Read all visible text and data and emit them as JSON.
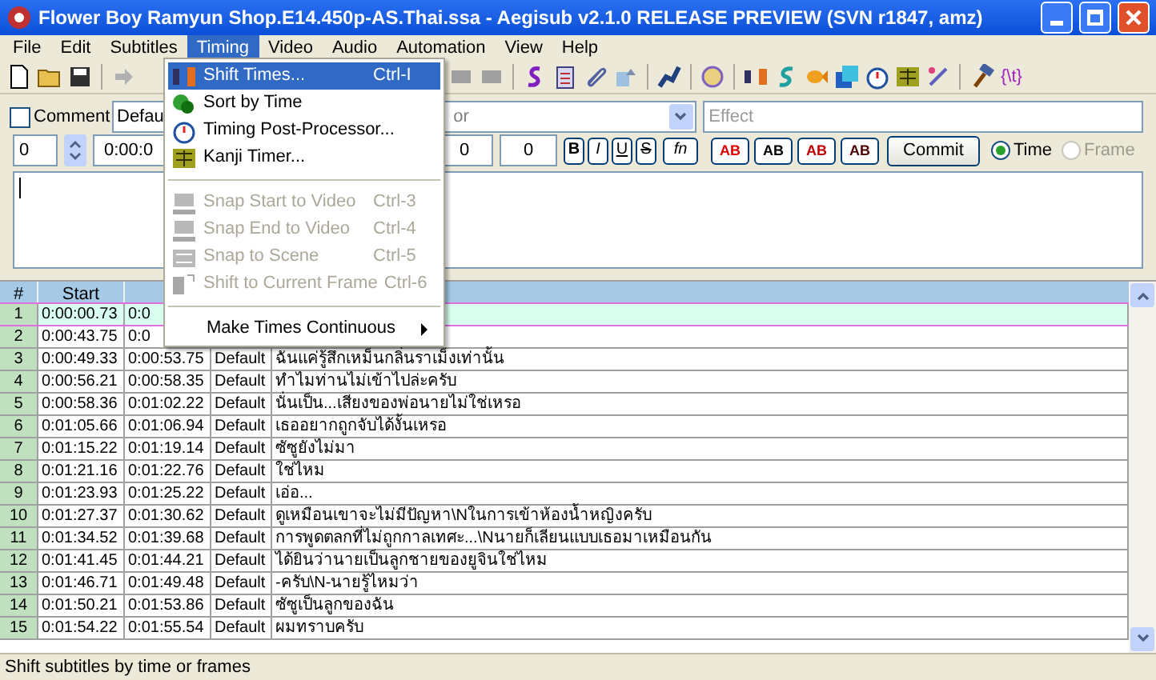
{
  "window": {
    "title": "Flower Boy Ramyun Shop.E14.450p-AS.Thai.ssa - Aegisub v2.1.0 RELEASE PREVIEW (SVN r1847, amz)"
  },
  "menu_bar": [
    {
      "label": "File",
      "selected": false
    },
    {
      "label": "Edit",
      "selected": false
    },
    {
      "label": "Subtitles",
      "selected": false
    },
    {
      "label": "Timing",
      "selected": true
    },
    {
      "label": "Video",
      "selected": false
    },
    {
      "label": "Audio",
      "selected": false
    },
    {
      "label": "Automation",
      "selected": false
    },
    {
      "label": "View",
      "selected": false
    },
    {
      "label": "Help",
      "selected": false
    }
  ],
  "toolbar": {
    "tag_button": "{\\t}"
  },
  "timing_menu": [
    {
      "kind": "item",
      "label": "Shift Times...",
      "shortcut": "Ctrl-I",
      "selected": true,
      "disabled": false
    },
    {
      "kind": "item",
      "label": "Sort by Time",
      "selected": false,
      "disabled": false
    },
    {
      "kind": "item",
      "label": "Timing Post-Processor...",
      "selected": false,
      "disabled": false
    },
    {
      "kind": "item",
      "label": "Kanji Timer...",
      "selected": false,
      "disabled": false
    },
    {
      "kind": "separator"
    },
    {
      "kind": "item",
      "label": "Snap Start to Video",
      "shortcut": "Ctrl-3",
      "selected": false,
      "disabled": true
    },
    {
      "kind": "item",
      "label": "Snap End to Video",
      "shortcut": "Ctrl-4",
      "selected": false,
      "disabled": true
    },
    {
      "kind": "item",
      "label": "Snap to Scene",
      "shortcut": "Ctrl-5",
      "selected": false,
      "disabled": true
    },
    {
      "kind": "item",
      "label": "Shift to Current Frame",
      "shortcut": "Ctrl-6",
      "selected": false,
      "disabled": true
    },
    {
      "kind": "separator"
    },
    {
      "kind": "submenu",
      "label": "Make Times Continuous",
      "selected": false,
      "disabled": false
    }
  ],
  "editor": {
    "comment": {
      "label": "Comment",
      "checked": false
    },
    "style": "Defau",
    "actor_placeholder": "or",
    "effect_placeholder": "Effect",
    "layer": "0",
    "start_time": "0:00:0",
    "margins": [
      "0",
      "0"
    ],
    "format_buttons": [
      "B",
      "I",
      "U",
      "S",
      "fn"
    ],
    "color_buttons": [
      "AB",
      "AB",
      "AB",
      "AB"
    ],
    "commit": "Commit",
    "time_mode": [
      {
        "label": "Time",
        "selected": true,
        "disabled": false
      },
      {
        "label": "Frame",
        "selected": false,
        "disabled": true
      }
    ]
  },
  "grid": {
    "columns": [
      "#",
      "Start"
    ],
    "rows": [
      {
        "number": "1",
        "start": "0:00:00.73",
        "end": "0:0",
        "selected": true
      },
      {
        "number": "2",
        "start": "0:00:43.75",
        "end": "0:0",
        "selected": false
      },
      {
        "number": "3",
        "start": "0:00:49.33",
        "end": "0:00:53.75",
        "style": "Default",
        "text": "ฉันแค่รู้สึกเหม็นกลิ่นราเม็งเท่านั้น",
        "selected": false
      },
      {
        "number": "4",
        "start": "0:00:56.21",
        "end": "0:00:58.35",
        "style": "Default",
        "text": "ทำไมท่านไม่เข้าไปล่ะครับ",
        "selected": false
      },
      {
        "number": "5",
        "start": "0:00:58.36",
        "end": "0:01:02.22",
        "style": "Default",
        "text": "นั่นเป็น...เสียงของพ่อนายไม่ใช่เหรอ",
        "selected": false
      },
      {
        "number": "6",
        "start": "0:01:05.66",
        "end": "0:01:06.94",
        "style": "Default",
        "text": "เธออยากถูกจับได้งั้นเหรอ",
        "selected": false
      },
      {
        "number": "7",
        "start": "0:01:15.22",
        "end": "0:01:19.14",
        "style": "Default",
        "text": "ซัซูยังไม่มา",
        "selected": false
      },
      {
        "number": "8",
        "start": "0:01:21.16",
        "end": "0:01:22.76",
        "style": "Default",
        "text": "ใช่ไหม",
        "selected": false
      },
      {
        "number": "9",
        "start": "0:01:23.93",
        "end": "0:01:25.22",
        "style": "Default",
        "text": "เอ่อ...",
        "selected": false
      },
      {
        "number": "10",
        "start": "0:01:27.37",
        "end": "0:01:30.62",
        "style": "Default",
        "text": "ดูเหมือนเขาจะไม่มีปัญหา\\Nในการเข้าห้องน้ำหญิงครับ",
        "selected": false
      },
      {
        "number": "11",
        "start": "0:01:34.52",
        "end": "0:01:39.68",
        "style": "Default",
        "text": "การพูดตลกที่ไม่ถูกกาลเทศะ...\\Nนายก็เลียนแบบเธอมาเหมือนกัน",
        "selected": false
      },
      {
        "number": "12",
        "start": "0:01:41.45",
        "end": "0:01:44.21",
        "style": "Default",
        "text": "ได้ยินว่านายเป็นลูกชายของยูจินใช่ไหม",
        "selected": false
      },
      {
        "number": "13",
        "start": "0:01:46.71",
        "end": "0:01:49.48",
        "style": "Default",
        "text": "-ครับ\\N-นายรู้ไหมว่า",
        "selected": false
      },
      {
        "number": "14",
        "start": "0:01:50.21",
        "end": "0:01:53.86",
        "style": "Default",
        "text": "ซัซูเป็นลูกของฉัน",
        "selected": false
      },
      {
        "number": "15",
        "start": "0:01:54.22",
        "end": "0:01:55.54",
        "style": "Default",
        "text": "ผมทราบครับ",
        "selected": false
      }
    ]
  },
  "status_bar": "Shift subtitles by time or frames"
}
